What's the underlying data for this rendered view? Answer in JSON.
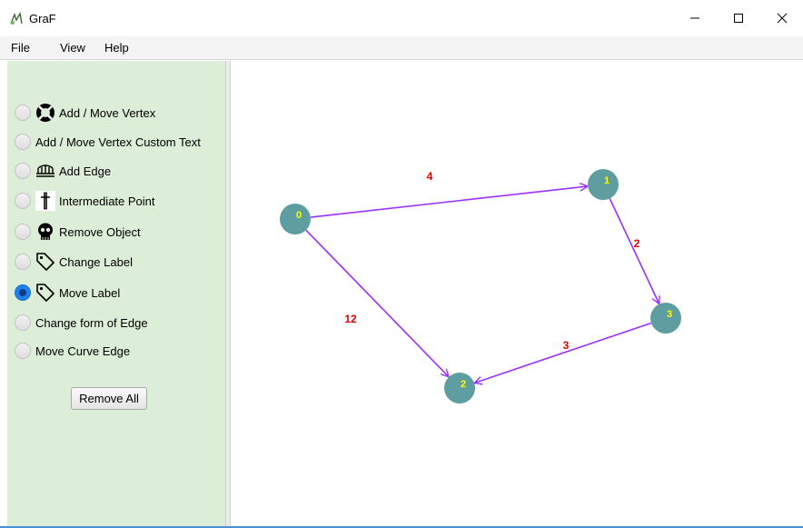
{
  "window": {
    "title": "GraF"
  },
  "menu": [
    "File",
    "View",
    "Help"
  ],
  "tools": [
    {
      "label": "Add / Move Vertex",
      "icon": "life-ring-icon",
      "selected": false
    },
    {
      "label": "Add / Move Vertex Custom Text",
      "icon": "",
      "selected": false
    },
    {
      "label": "Add Edge",
      "icon": "bridge-icon",
      "selected": false
    },
    {
      "label": "Intermediate Point",
      "icon": "cross-icon",
      "selected": false
    },
    {
      "label": "Remove Object",
      "icon": "skull-icon",
      "selected": false
    },
    {
      "label": "Change Label",
      "icon": "tag-icon",
      "selected": false
    },
    {
      "label": "Move Label",
      "icon": "tag-icon",
      "selected": true
    },
    {
      "label": "Change form of Edge",
      "icon": "",
      "selected": false
    },
    {
      "label": "Move Curve Edge",
      "icon": "",
      "selected": false
    }
  ],
  "remove_all_label": "Remove All",
  "graph": {
    "vertices": [
      {
        "id": "0",
        "label": "0"
      },
      {
        "id": "1",
        "label": "1"
      },
      {
        "id": "2",
        "label": "2"
      },
      {
        "id": "3",
        "label": "3"
      }
    ],
    "edges": [
      {
        "from": "0",
        "to": "1",
        "weight": "4"
      },
      {
        "from": "1",
        "to": "3",
        "weight": "2"
      },
      {
        "from": "0",
        "to": "2",
        "weight": "12"
      },
      {
        "from": "3",
        "to": "2",
        "weight": "3"
      }
    ],
    "colors": {
      "vertex": "#5f9ea0",
      "vertex_label": "#ffff00",
      "edge": "#9b30ff",
      "weight": "#e00000"
    }
  }
}
